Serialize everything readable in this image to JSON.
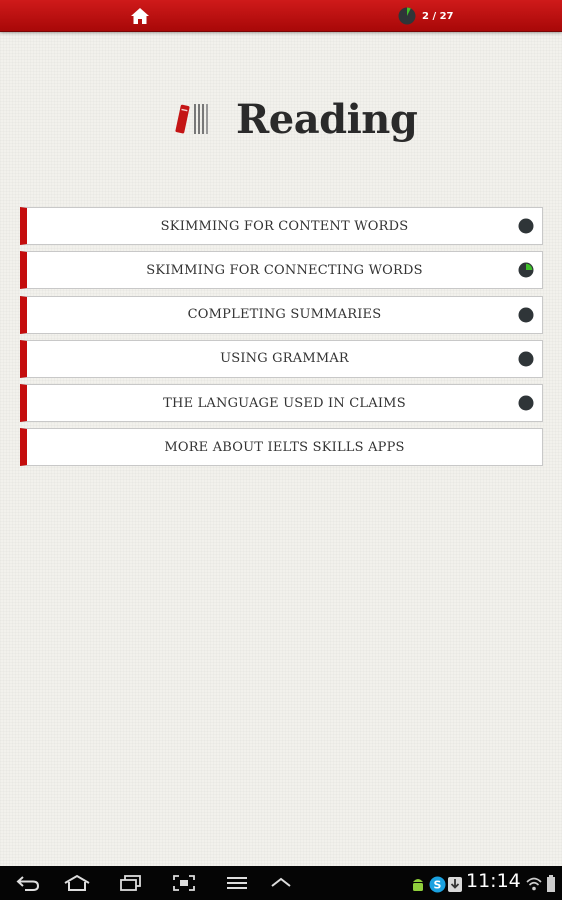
{
  "topbar": {
    "home_icon": "home-icon",
    "progress_text": "2 / 27",
    "progress_fraction": 0.074
  },
  "header": {
    "title": "Reading",
    "icon": "book-icon"
  },
  "menu": {
    "items": [
      {
        "label": "SKIMMING FOR CONTENT WORDS",
        "progress": 0
      },
      {
        "label": "SKIMMING FOR CONNECTING WORDS",
        "progress": 0.25
      },
      {
        "label": "COMPLETING SUMMARIES",
        "progress": 0
      },
      {
        "label": "USING GRAMMAR",
        "progress": 0
      },
      {
        "label": "THE LANGUAGE USED IN CLAIMS",
        "progress": 0
      },
      {
        "label": "MORE ABOUT IELTS SKILLS APPS"
      }
    ]
  },
  "system_bar": {
    "time": "11:14",
    "nav_icons": [
      "back-icon",
      "home-icon",
      "recent-apps-icon",
      "screenshot-icon",
      "menu-icon",
      "up-chevron-icon"
    ],
    "tray_icons": [
      "android-icon",
      "skype-icon",
      "download-icon",
      "wifi-icon"
    ]
  },
  "colors": {
    "topbar_red": "#c01212",
    "accent_red": "#c40d0d",
    "progress_green": "#3fbf2a",
    "status_dark": "#2f3538"
  }
}
